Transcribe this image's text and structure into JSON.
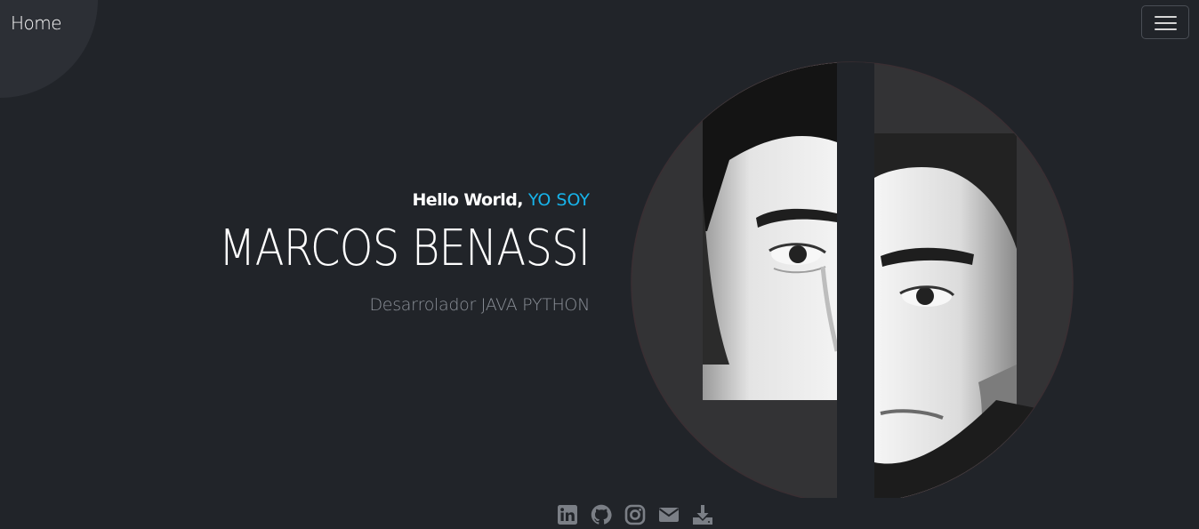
{
  "nav": {
    "home_label": "Home",
    "menu_icon": "hamburger-icon"
  },
  "hero": {
    "greeting": "Hello World,",
    "greeting_accent": "YO SOY",
    "name": "MARCOS BENASSI",
    "role": "Desarrolador JAVA PYTHON"
  },
  "social": {
    "icons": [
      "linkedin-icon",
      "github-icon",
      "instagram-icon",
      "email-icon",
      "download-icon"
    ]
  },
  "colors": {
    "background": "#212429",
    "accent": "#17b3ea",
    "muted_text": "#8c9199",
    "icon": "#7b7f86"
  }
}
